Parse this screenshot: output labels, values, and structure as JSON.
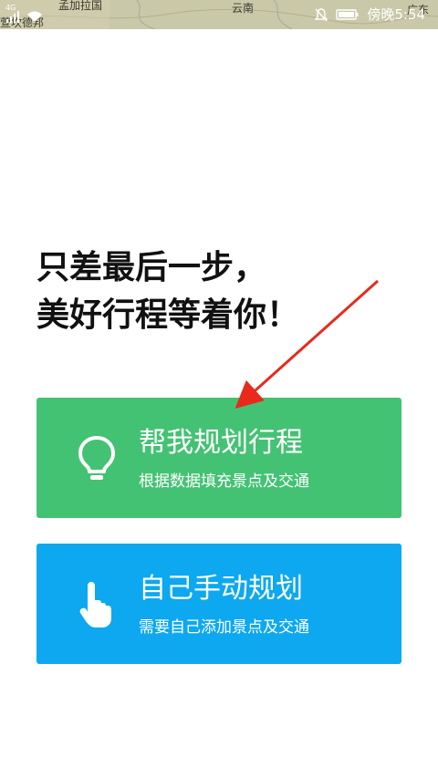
{
  "status_bar": {
    "network": "4G",
    "time": "傍晚5:54",
    "map_labels": [
      "孟加拉国",
      "云南",
      "广东",
      "萱坎德邦"
    ],
    "icons": [
      "signal-icon",
      "wifi-icon",
      "mute-bell-icon",
      "battery-icon"
    ]
  },
  "headline": {
    "line1": "只差最后一步，",
    "line2": "美好行程等着你！"
  },
  "cards": [
    {
      "title": "帮我规划行程",
      "subtitle": "根据数据填充景点及交通",
      "icon": "lightbulb-icon",
      "color": "#44c274"
    },
    {
      "title": "自己手动规划",
      "subtitle": "需要自己添加景点及交通",
      "icon": "hand-tap-icon",
      "color": "#0da8f0"
    }
  ],
  "annotation": {
    "arrow_color": "#e8291c"
  }
}
